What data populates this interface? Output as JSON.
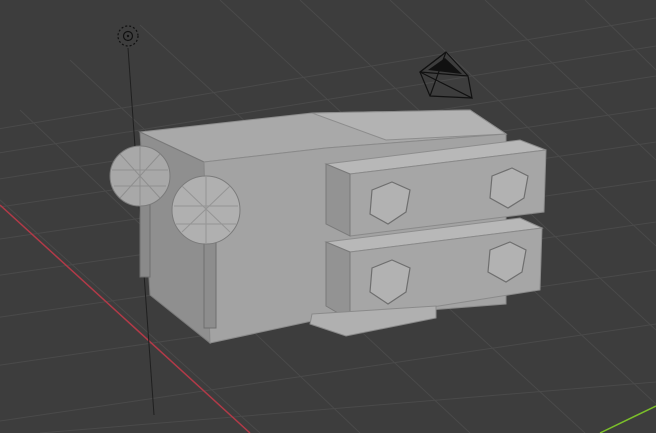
{
  "viewport": {
    "view": "3D Viewport",
    "background_color": "#3d3d3d",
    "grid_color": "#4a4a4a",
    "x_axis_color": "#b23a48",
    "y_axis_color": "#7bbf2a"
  },
  "scene": {
    "objects": [
      {
        "name": "light",
        "icon": "light-icon"
      },
      {
        "name": "camera",
        "icon": "camera-icon"
      },
      {
        "name": "mesh-body",
        "icon": "mesh-icon"
      },
      {
        "name": "sphere-left",
        "icon": "mesh-icon"
      },
      {
        "name": "sphere-right",
        "icon": "mesh-icon"
      },
      {
        "name": "drawer-top",
        "icon": "mesh-icon"
      },
      {
        "name": "drawer-bottom",
        "icon": "mesh-icon"
      }
    ]
  }
}
